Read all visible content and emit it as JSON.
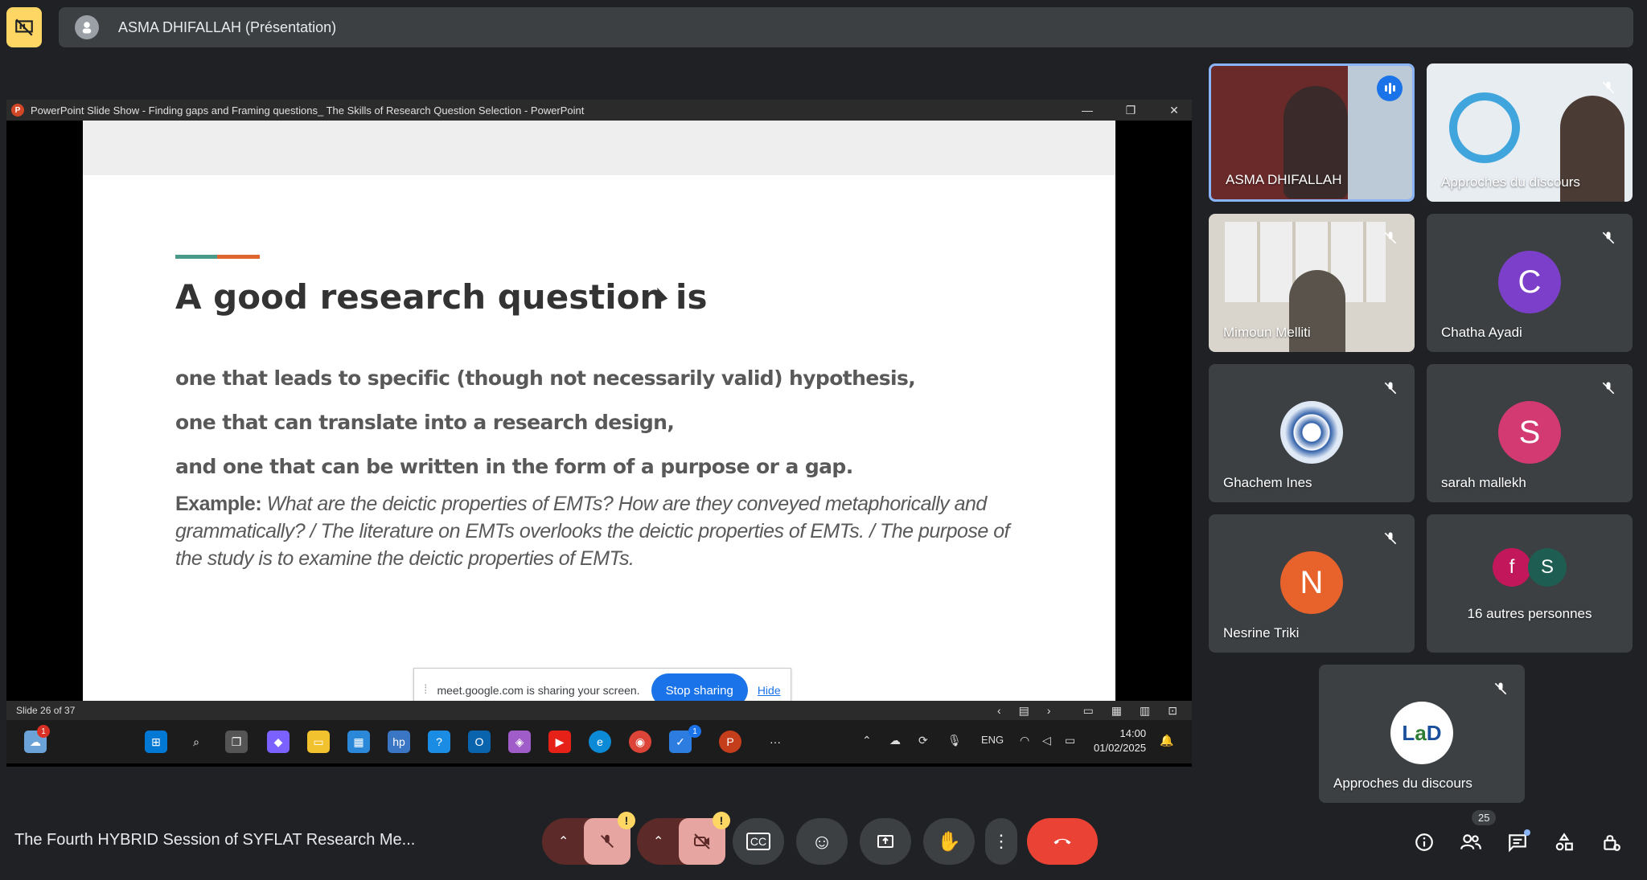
{
  "presenter_bar": {
    "name": "ASMA DHIFALLAH (Présentation)"
  },
  "ppt_window": {
    "title": "PowerPoint Slide Show  -  Finding gaps and Framing questions_ The Skills of Research Question Selection - PowerPoint",
    "slide_count": "Slide 26 of 37"
  },
  "slide": {
    "title": "A good research question is",
    "bullets": [
      "one that leads to specific (though not necessarily valid) hypothesis,",
      "one that can translate into a research design,",
      "and one that can be written in the form of a purpose or a gap."
    ],
    "example_label": "Example:",
    "example_text": "What are the deictic properties of EMTs? How are they conveyed metaphorically and grammatically? / The literature on EMTs overlooks the deictic properties of EMTs. / The purpose of the study is to examine the deictic properties of EMTs."
  },
  "share_banner": {
    "text": "meet.google.com is sharing your screen.",
    "stop_label": "Stop sharing",
    "hide_label": "Hide"
  },
  "taskbar": {
    "weather_badge": "1",
    "lang": "ENG",
    "time": "14:00",
    "date": "01/02/2025",
    "m365_badge": "1"
  },
  "participants": [
    {
      "name": "ASMA DHIFALLAH",
      "speaking": true
    },
    {
      "name": "Approches du discours",
      "muted": true
    },
    {
      "name": "Mimoun Melliti",
      "muted": true
    },
    {
      "name": "Chatha Ayadi",
      "initial": "C",
      "color": "#7b3fc9",
      "muted": true
    },
    {
      "name": "Ghachem Ines",
      "muted": true
    },
    {
      "name": "sarah mallekh",
      "initial": "S",
      "color": "#d33a71",
      "muted": true
    },
    {
      "name": "Nesrine Triki",
      "initial": "N",
      "color": "#e8622b",
      "muted": true
    },
    {
      "name": "16 autres personnes",
      "initials": [
        "f",
        "S"
      ],
      "colors": [
        "#c2185b",
        "#1e5e52"
      ]
    },
    {
      "name": "Approches du discours",
      "logo_text": "LaD",
      "muted": true
    }
  ],
  "bottom_bar": {
    "meeting_title": "The Fourth HYBRID Session of SYFLAT Research Me...",
    "participant_count": "25",
    "warn_mark": "!"
  },
  "colors": {
    "background": "#202124",
    "tile": "#3c4043",
    "accent_blue": "#1a73e8",
    "end_call": "#ea4335",
    "muted_control": "#e6a5a0"
  }
}
